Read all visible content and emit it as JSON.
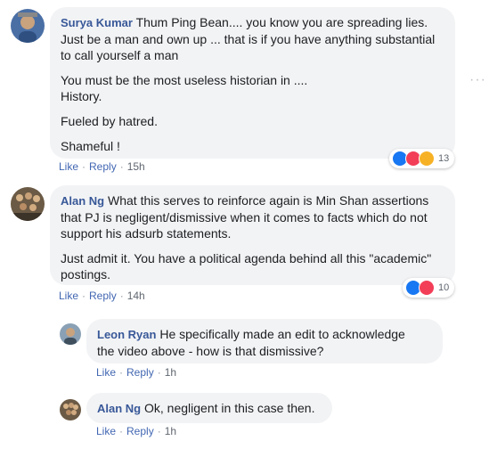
{
  "comments": [
    {
      "name": "Surya Kumar",
      "first_line": "Thum Ping Bean.... you know you are spreading lies.",
      "lines": [
        "Just be a man and own up ... that is if you have anything substantial",
        "to call yourself a man"
      ],
      "para2": [
        "You must be the most useless historian in ....",
        "History."
      ],
      "para3": "Fueled by hatred.",
      "para4": "Shameful !",
      "like": "Like",
      "reply": "Reply",
      "time": "15h",
      "reaction_count": "13",
      "reactions": [
        "like-icon",
        "love-icon",
        "haha-icon"
      ]
    },
    {
      "name": "Alan Ng",
      "first_line": "What this serves to reinforce again is Min Shan assertions",
      "lines": [
        "that PJ is negligent/dismissive when it comes to facts which do not",
        "support his adsurb statements."
      ],
      "para2": [
        "Just admit it. You have a political agenda behind all this \"academic\"",
        "postings."
      ],
      "like": "Like",
      "reply": "Reply",
      "time": "14h",
      "reaction_count": "10",
      "reactions": [
        "like-icon",
        "love-icon"
      ]
    },
    {
      "name": "Leon Ryan",
      "first_line": "He specifically made an edit to acknowledge",
      "lines": [
        "the video above - how is that dismissive?"
      ],
      "like": "Like",
      "reply": "Reply",
      "time": "1h"
    },
    {
      "name": "Alan Ng",
      "first_line": "Ok, negligent in this case then.",
      "like": "Like",
      "reply": "Reply",
      "time": "1h"
    }
  ],
  "more_menu": "···",
  "separator": "·"
}
